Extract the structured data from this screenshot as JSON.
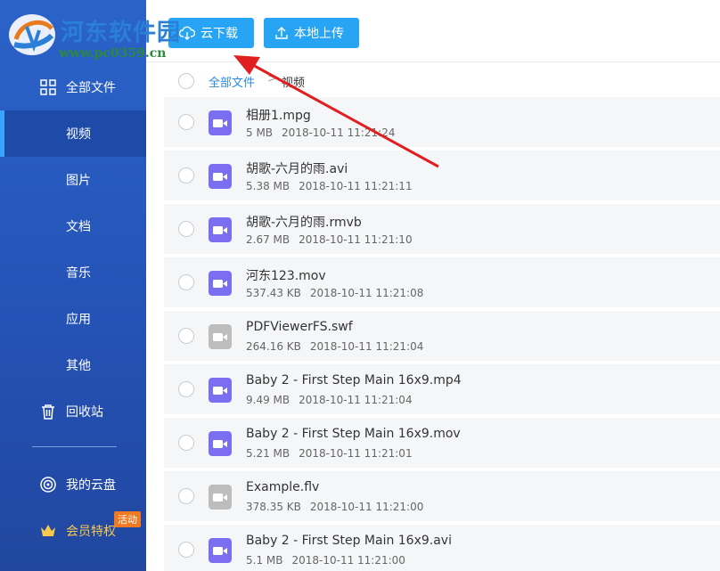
{
  "logo": {
    "text": "河东软件园",
    "url": "www.pc0359.cn"
  },
  "sidebar": {
    "items": [
      {
        "label": "全部文件",
        "icon": "grid-icon"
      },
      {
        "label": "视频",
        "active": true
      },
      {
        "label": "图片"
      },
      {
        "label": "文档"
      },
      {
        "label": "音乐"
      },
      {
        "label": "应用"
      },
      {
        "label": "其他"
      },
      {
        "label": "回收站",
        "icon": "trash-icon"
      }
    ],
    "bottom": [
      {
        "label": "我的云盘",
        "icon": "cloud-disk-icon"
      },
      {
        "label": "会员特权",
        "icon": "crown-icon",
        "badge": "活动"
      }
    ]
  },
  "toolbar": {
    "download_label": "云下载",
    "upload_label": "本地上传"
  },
  "breadcrumb": {
    "root": "全部文件",
    "separator": ">",
    "current": "视频"
  },
  "files": [
    {
      "name": "相册1.mpg",
      "size": "5 MB",
      "date": "2018-10-11 11:21:24",
      "type": "video"
    },
    {
      "name": "胡歌-六月的雨.avi",
      "size": "5.38 MB",
      "date": "2018-10-11 11:21:11",
      "type": "video"
    },
    {
      "name": "胡歌-六月的雨.rmvb",
      "size": "2.67 MB",
      "date": "2018-10-11 11:21:10",
      "type": "video"
    },
    {
      "name": "河东123.mov",
      "size": "537.43 KB",
      "date": "2018-10-11 11:21:08",
      "type": "video"
    },
    {
      "name": "PDFViewerFS.swf",
      "size": "264.16 KB",
      "date": "2018-10-11 11:21:04",
      "type": "unknown"
    },
    {
      "name": "Baby 2 - First Step Main 16x9.mp4",
      "size": "9.49 MB",
      "date": "2018-10-11 11:21:04",
      "type": "video"
    },
    {
      "name": "Baby 2 - First Step Main 16x9.mov",
      "size": "5.21 MB",
      "date": "2018-10-11 11:21:01",
      "type": "video"
    },
    {
      "name": "Example.flv",
      "size": "378.35 KB",
      "date": "2018-10-11 11:21:00",
      "type": "unknown"
    },
    {
      "name": "Baby 2 - First Step Main 16x9.avi",
      "size": "5.1 MB",
      "date": "2018-10-11 11:21:00",
      "type": "video"
    }
  ],
  "colors": {
    "sidebar": "#2451b4",
    "accent": "#28a4f4",
    "video_icon": "#7b6ef0",
    "unknown_icon": "#bdbdbd",
    "annotation_arrow": "#e02020"
  }
}
